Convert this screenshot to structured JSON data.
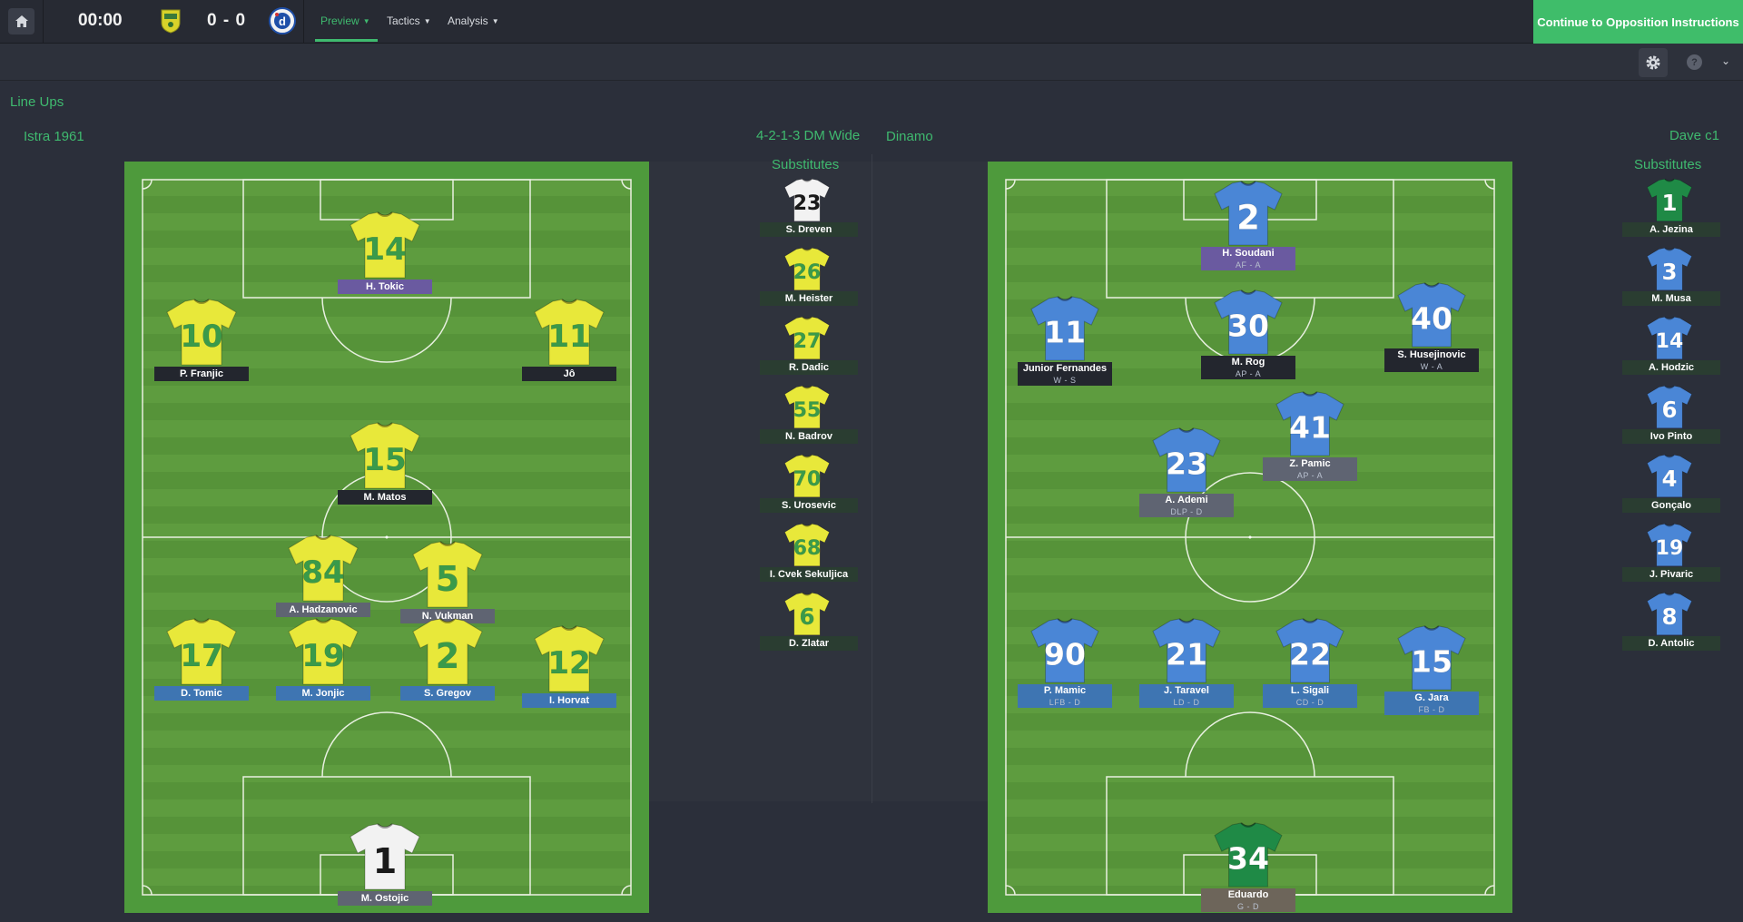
{
  "topbar": {
    "clock": "00:00",
    "score": "0 - 0",
    "tabs": [
      {
        "label": "Preview",
        "active": true
      },
      {
        "label": "Tactics",
        "active": false
      },
      {
        "label": "Analysis",
        "active": false
      }
    ],
    "continue_label": "Continue to Opposition Instructions"
  },
  "colors": {
    "accent": "#3fba6f",
    "home_shirt": "#e8e83a",
    "away_shirt": "#4a86d6",
    "gk_home": "#f2f2f2",
    "gk_away": "#1f8a46"
  },
  "lineups": {
    "section_title": "Line Ups",
    "home": {
      "team": "Istra 1961",
      "formation": "4-2-1-3 DM Wide",
      "substitutes_label": "Substitutes",
      "players": [
        {
          "number": "14",
          "name": "H. Tokic"
        },
        {
          "number": "10",
          "name": "P. Franjic"
        },
        {
          "number": "11",
          "name": "Jô"
        },
        {
          "number": "15",
          "name": "M. Matos"
        },
        {
          "number": "84",
          "name": "A. Hadzanovic"
        },
        {
          "number": "5",
          "name": "N. Vukman"
        },
        {
          "number": "17",
          "name": "D. Tomic"
        },
        {
          "number": "19",
          "name": "M. Jonjic"
        },
        {
          "number": "2",
          "name": "S. Gregov"
        },
        {
          "number": "12",
          "name": "I. Horvat"
        },
        {
          "number": "1",
          "name": "M. Ostojic"
        }
      ],
      "subs": [
        {
          "number": "23",
          "name": "S. Dreven"
        },
        {
          "number": "26",
          "name": "M. Heister"
        },
        {
          "number": "27",
          "name": "R. Dadic"
        },
        {
          "number": "55",
          "name": "N. Badrov"
        },
        {
          "number": "70",
          "name": "S. Urosevic"
        },
        {
          "number": "68",
          "name": "I. Cvek Sekuljica"
        },
        {
          "number": "6",
          "name": "D. Zlatar"
        }
      ]
    },
    "away": {
      "team": "Dinamo",
      "manager": "Dave c1",
      "substitutes_label": "Substitutes",
      "players": [
        {
          "number": "2",
          "name": "H. Soudani",
          "role": "AF - A"
        },
        {
          "number": "11",
          "name": "Junior Fernandes",
          "role": "W - S"
        },
        {
          "number": "30",
          "name": "M. Rog",
          "role": "AP - A"
        },
        {
          "number": "40",
          "name": "S. Husejinovic",
          "role": "W - A"
        },
        {
          "number": "41",
          "name": "Z. Pamic",
          "role": "AP - A"
        },
        {
          "number": "23",
          "name": "A. Ademi",
          "role": "DLP - D"
        },
        {
          "number": "90",
          "name": "P. Mamic",
          "role": "LFB - D"
        },
        {
          "number": "21",
          "name": "J. Taravel",
          "role": "LD - D"
        },
        {
          "number": "22",
          "name": "L. Sigali",
          "role": "CD - D"
        },
        {
          "number": "15",
          "name": "G. Jara",
          "role": "FB - D"
        },
        {
          "number": "34",
          "name": "Eduardo",
          "role": "G - D"
        }
      ],
      "subs": [
        {
          "number": "1",
          "name": "A. Jezina"
        },
        {
          "number": "3",
          "name": "M. Musa"
        },
        {
          "number": "14",
          "name": "A. Hodzic"
        },
        {
          "number": "6",
          "name": "Ivo Pinto"
        },
        {
          "number": "4",
          "name": "Gonçalo"
        },
        {
          "number": "19",
          "name": "J. Pivaric"
        },
        {
          "number": "8",
          "name": "D. Antolic"
        }
      ]
    }
  }
}
